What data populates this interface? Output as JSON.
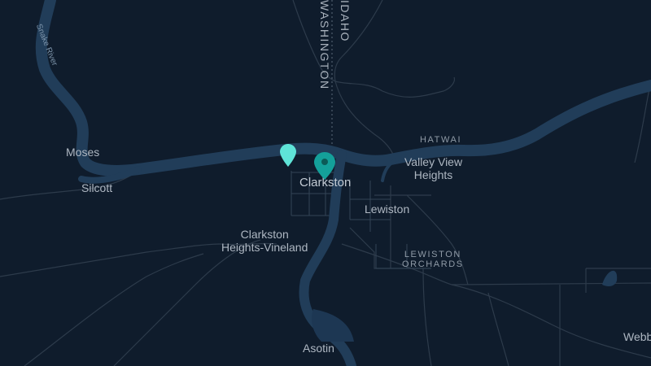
{
  "colors": {
    "background": "#0f1c2c",
    "water": "#213d59",
    "road": "#2d3b4b",
    "marker_primary": "#14a09a",
    "marker_secondary": "#5fe4d8"
  },
  "map": {
    "borders": {
      "state_1": "IDAHO",
      "state_2": "WASHINGTON"
    },
    "labels": {
      "snake_river": "Snake River",
      "moses": "Moses",
      "silcott": "Silcott",
      "hatwai": "HATWAI",
      "valley_view": "Valley View\nHeights",
      "clarkston": "Clarkston",
      "lewiston": "Lewiston",
      "clarkston_heights": "Clarkston\nHeights-Vineland",
      "lewiston_orchards": "LEWISTON\nORCHARDS",
      "asotin": "Asotin",
      "webb": "Webb"
    },
    "markers": [
      {
        "name": "selected-location",
        "icon": "map-pin-icon",
        "color": "#14a09a"
      },
      {
        "name": "secondary-location",
        "icon": "map-pin-icon",
        "color": "#5fe4d8"
      }
    ]
  }
}
